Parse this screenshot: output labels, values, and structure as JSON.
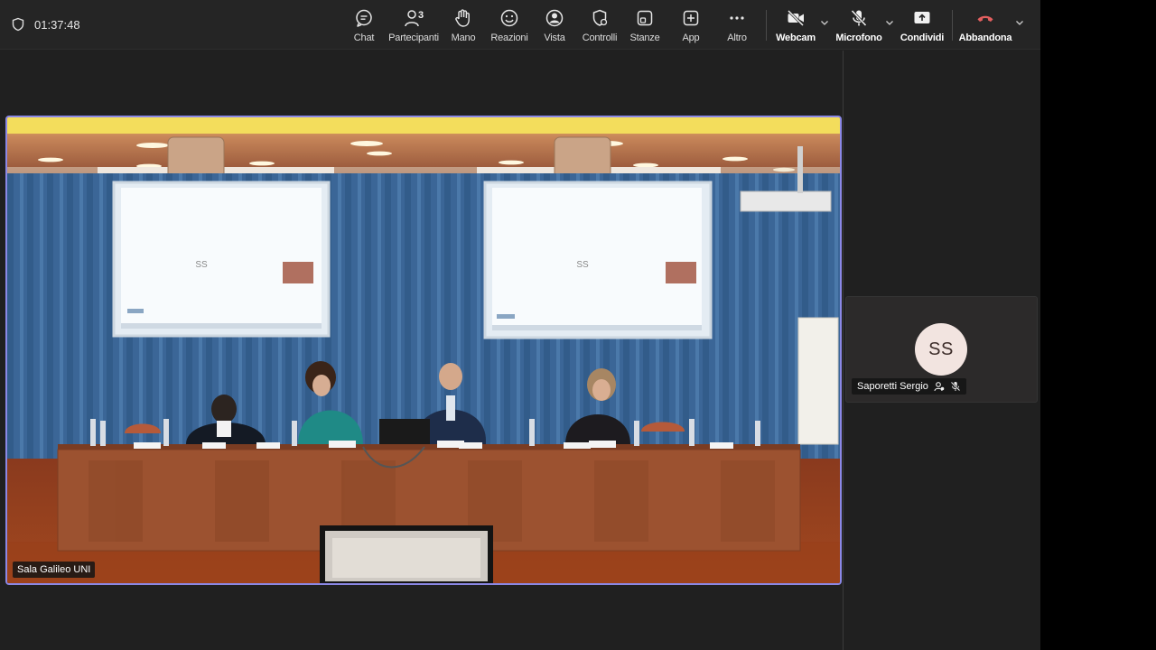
{
  "meeting": {
    "timer": "01:37:48"
  },
  "toolbar": {
    "chat": "Chat",
    "participants": "Partecipanti",
    "participants_count": "3",
    "hand": "Mano",
    "reactions": "Reazioni",
    "view": "Vista",
    "controls": "Controlli",
    "rooms": "Stanze",
    "apps": "App",
    "more": "Altro",
    "webcam": "Webcam",
    "microphone": "Microfono",
    "share": "Condividi",
    "leave": "Abbandona"
  },
  "stage": {
    "video_tile_name": "Sala Galileo UNI",
    "screen_initials": "SS"
  },
  "participants": [
    {
      "name": "Saporetti Sergio",
      "initials": "SS"
    }
  ],
  "colors": {
    "active_border": "#8b88e6",
    "leave_red": "#e35f5f",
    "avatar_bg": "#f2e4e0"
  }
}
